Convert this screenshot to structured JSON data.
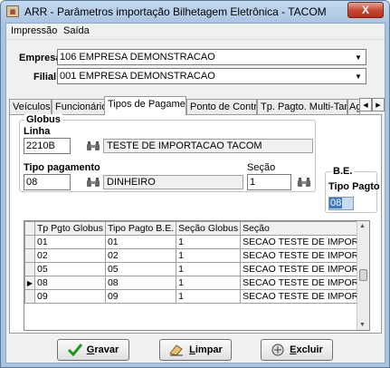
{
  "window": {
    "title": "ARR - Parâmetros importação Bilhetagem Eletrônica - TACOM",
    "close_label": "X"
  },
  "menu": [
    "Impressão",
    "Saída"
  ],
  "empresa": {
    "label": "Empresa",
    "value": "106 EMPRESA DEMONSTRACAO"
  },
  "filial": {
    "label": "Filial",
    "value": "001 EMPRESA DEMONSTRACAO"
  },
  "tabs": [
    "Veículos",
    "Funcionários",
    "Tipos de Pagamento",
    "Ponto de Controle",
    "Tp. Pagto. Multi-Tarifa",
    "Agê"
  ],
  "active_tab": "Tipos de Pagamento",
  "globus": {
    "title": "Globus",
    "linha_label": "Linha",
    "linha_code": "2210B",
    "linha_desc": "TESTE DE IMPORTACAO TACOM",
    "tipo_pagamento_label": "Tipo pagamento",
    "tipo_pagamento_code": "08",
    "tipo_pagamento_desc": "DINHEIRO",
    "secao_label": "Seção",
    "secao_value": "1"
  },
  "be": {
    "title": "B.E.",
    "tipo_pagto_label": "Tipo Pagto",
    "tipo_pagto_value": "08"
  },
  "grid": {
    "columns": [
      "Tp Pgto Globus",
      "Tipo Pagto B.E.",
      "Seção Globus",
      "Seção"
    ],
    "rows": [
      [
        "01",
        "01",
        "1",
        "SECAO TESTE DE IMPOR"
      ],
      [
        "02",
        "02",
        "1",
        "SECAO TESTE DE IMPOR"
      ],
      [
        "05",
        "05",
        "1",
        "SECAO TESTE DE IMPOR"
      ],
      [
        "08",
        "08",
        "1",
        "SECAO TESTE DE IMPOR"
      ],
      [
        "09",
        "09",
        "1",
        "SECAO TESTE DE IMPOR"
      ]
    ],
    "current_row_index": 3
  },
  "buttons": {
    "gravar": {
      "underlined": "G",
      "rest": "ravar"
    },
    "limpar": {
      "underlined": "L",
      "rest": "impar"
    },
    "excluir": {
      "underlined": "E",
      "rest": "xcluir"
    }
  },
  "colors": {
    "titlebar": "#a9c4e2",
    "selection": "#3a78c8",
    "check_green": "#1a9a1a"
  }
}
